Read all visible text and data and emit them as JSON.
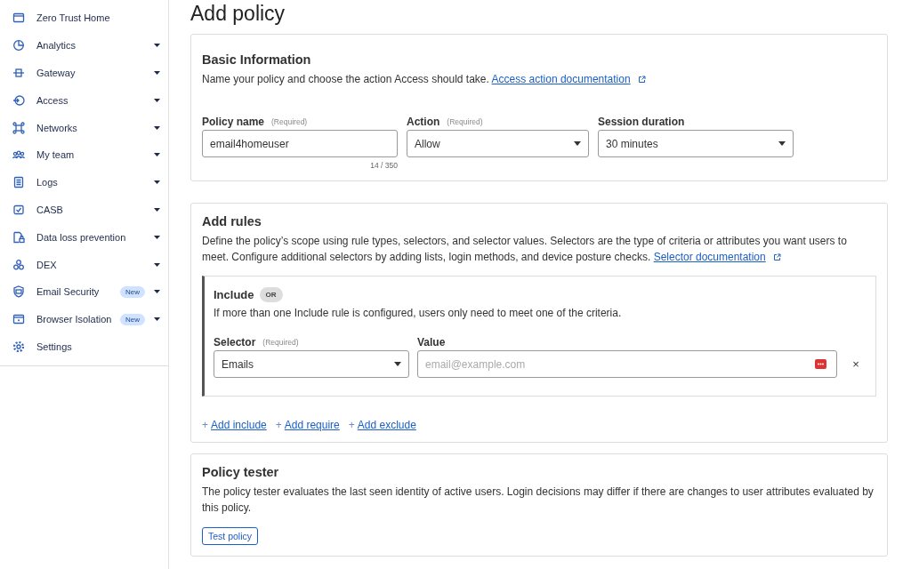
{
  "sidebar": {
    "items": [
      {
        "label": "Zero Trust Home",
        "expandable": false
      },
      {
        "label": "Analytics",
        "expandable": true
      },
      {
        "label": "Gateway",
        "expandable": true
      },
      {
        "label": "Access",
        "expandable": true
      },
      {
        "label": "Networks",
        "expandable": true
      },
      {
        "label": "My team",
        "expandable": true
      },
      {
        "label": "Logs",
        "expandable": true
      },
      {
        "label": "CASB",
        "expandable": true
      },
      {
        "label": "Data loss prevention",
        "expandable": true
      },
      {
        "label": "DEX",
        "expandable": true
      },
      {
        "label": "Email Security",
        "expandable": true,
        "badge": "New"
      },
      {
        "label": "Browser Isolation",
        "expandable": true,
        "badge": "New"
      },
      {
        "label": "Settings",
        "expandable": false
      }
    ]
  },
  "page_title": "Add policy",
  "basic_information": {
    "title": "Basic Information",
    "description": "Name your policy and choose the action Access should take.",
    "link": "Access action documentation",
    "fields": [
      {
        "kind": "text",
        "label": "Policy name",
        "required": "(Required)",
        "value": "email4homeuser",
        "counter": "14 / 350"
      },
      {
        "kind": "select",
        "label": "Action",
        "required": "(Required)",
        "value": "Allow"
      },
      {
        "kind": "select",
        "label": "Session duration",
        "value": "30 minutes"
      }
    ]
  },
  "add_rules": {
    "title": "Add rules",
    "description": "Define the policy’s scope using rule types, selectors, and selector values. Selectors are the type of criteria or attributes you want users to meet. Configure additional selectors by adding lists, login methods, and device posture checks.",
    "link": "Selector documentation",
    "include": {
      "title": "Include",
      "badge": "OR",
      "description": "If more than one Include rule is configured, users only need to meet one of the criteria.",
      "selector": {
        "label": "Selector",
        "required": "(Required)",
        "value": "Emails"
      },
      "value": {
        "label": "Value",
        "placeholder": "email@example.com"
      },
      "remove": "×"
    },
    "actions": [
      {
        "icon": "+",
        "label": "Add include"
      },
      {
        "icon": "+",
        "label": "Add require"
      },
      {
        "icon": "+",
        "label": "Add exclude"
      }
    ]
  },
  "policy_tester": {
    "title": "Policy tester",
    "description": "The policy tester evaluates the last seen identity of active users. Login decisions may differ if there are changes to user attributes evaluated by this policy.",
    "button": "Test policy"
  }
}
